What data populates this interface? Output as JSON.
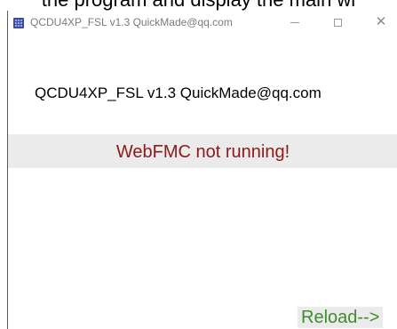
{
  "caption": {
    "text": "the program and display the main wi"
  },
  "window": {
    "title": "QCDU4XP_FSL v1.3  QuickMade@qq.com",
    "icon": "calculator-icon",
    "controls": {
      "minimize_icon": "minimize-icon",
      "maximize_icon": "maximize-icon",
      "close_icon": "close-icon",
      "close_glyph": "✕"
    }
  },
  "main": {
    "header": "QCDU4XP_FSL v1.3  QuickMade@qq.com",
    "status": "WebFMC not running!",
    "reload_label": "Reload-->"
  },
  "colors": {
    "status_text": "#8b1a1a",
    "status_band": "#ebebeb",
    "reload_text": "#3f8c2e",
    "window_border": "#5a5a5a"
  }
}
